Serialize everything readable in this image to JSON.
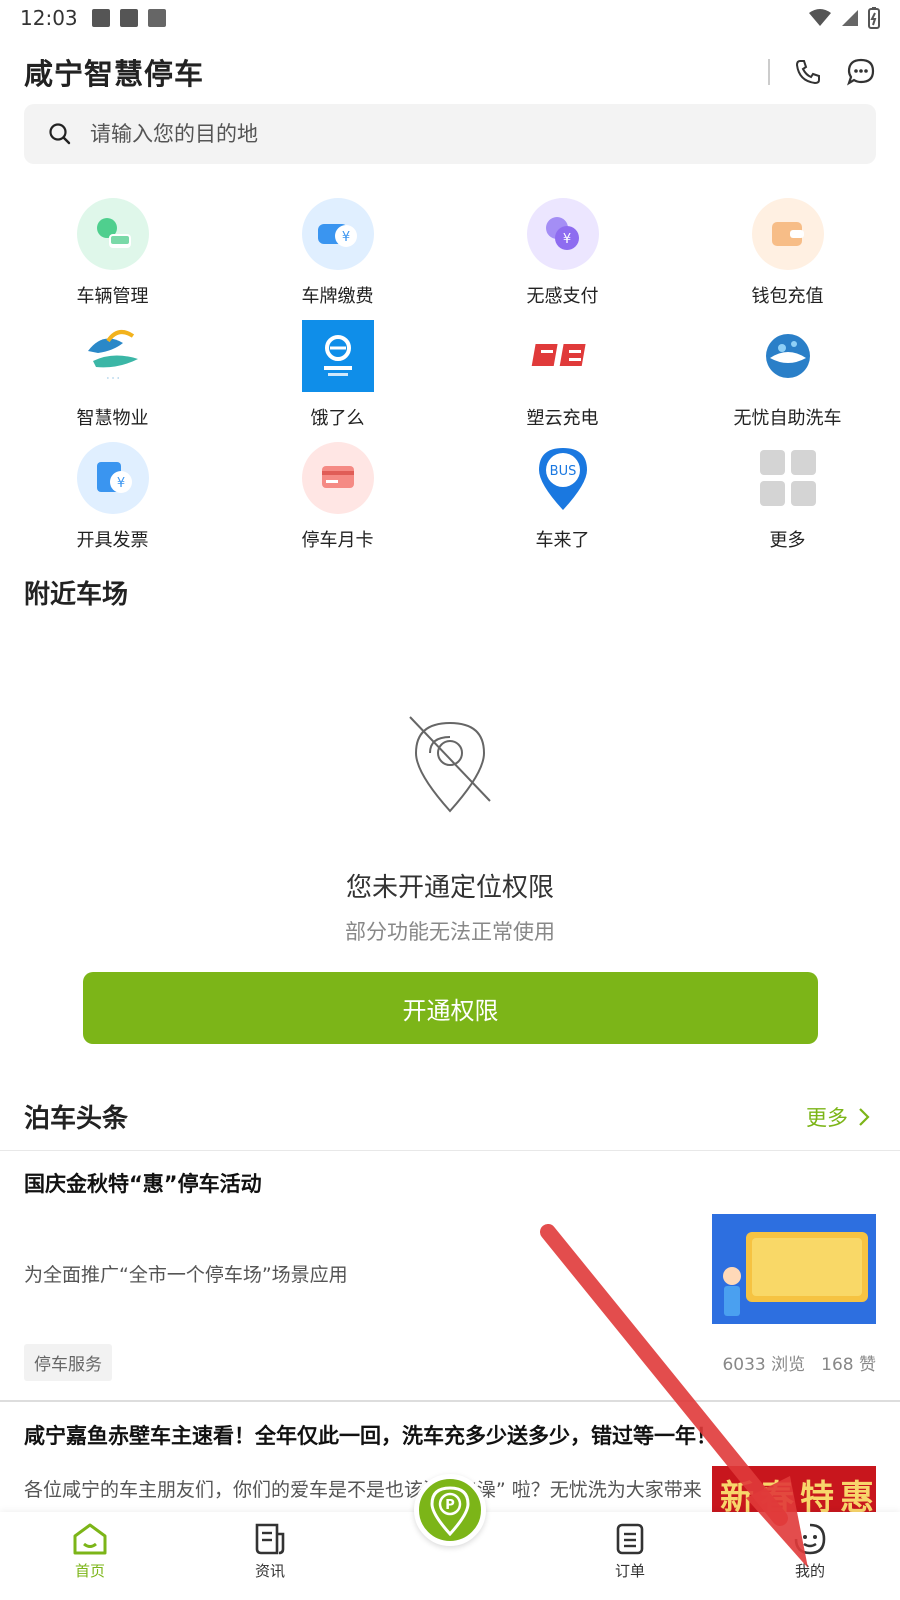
{
  "status_bar": {
    "time": "12:03"
  },
  "header": {
    "title": "咸宁智慧停车"
  },
  "search": {
    "placeholder": "请输入您的目的地"
  },
  "grid": [
    {
      "label": "车辆管理",
      "icon": "car-gear-icon",
      "color": "#4fcf8e"
    },
    {
      "label": "车牌缴费",
      "icon": "car-yuan-icon",
      "color": "#3a95f0"
    },
    {
      "label": "无感支付",
      "icon": "coin-yuan-icon",
      "color": "#8e6cf0"
    },
    {
      "label": "钱包充值",
      "icon": "wallet-icon",
      "color": "#f5a25a"
    },
    {
      "label": "智慧物业",
      "icon": "property-logo-icon",
      "color": "#2a88c8"
    },
    {
      "label": "饿了么",
      "icon": "eleme-logo-icon",
      "color": "#0f8ee9"
    },
    {
      "label": "塑云充电",
      "icon": "suyun-logo-icon",
      "color": "#e03a3a"
    },
    {
      "label": "无忧自助洗车",
      "icon": "carwash-logo-icon",
      "color": "#2a7fc8"
    },
    {
      "label": "开具发票",
      "icon": "invoice-icon",
      "color": "#3a95f0"
    },
    {
      "label": "停车月卡",
      "icon": "card-icon",
      "color": "#f06b6b"
    },
    {
      "label": "车来了",
      "icon": "bus-pin-icon",
      "color": "#1a78e0"
    },
    {
      "label": "更多",
      "icon": "more-grid-icon",
      "color": "#d0d0d0"
    }
  ],
  "nearby": {
    "title": "附近车场",
    "empty_title": "您未开通定位权限",
    "empty_sub": "部分功能无法正常使用",
    "button": "开通权限"
  },
  "news": {
    "title": "泊车头条",
    "more": "更多",
    "items": [
      {
        "title": "国庆金秋特“惠”停车活动",
        "summary": "为全面推广“全市一个停车场”场景应用",
        "tag": "停车服务",
        "views": "6033 浏览",
        "likes": "168 赞"
      },
      {
        "title": "咸宁嘉鱼赤壁车主速看！全年仅此一回，洗车充多少送多少，错过等一年！",
        "summary": "各位咸宁的车主朋友们，你们的爱车是不是也该洗个 “澡” 啦？无忧洗为大家带来一年仅此一次的新春特惠活动"
      }
    ]
  },
  "thumb2_text": "新春特惠",
  "bottom_nav": [
    {
      "label": "首页",
      "icon": "home-icon",
      "active": true
    },
    {
      "label": "资讯",
      "icon": "news-icon",
      "active": false
    },
    {
      "label": "",
      "icon": "parking-icon",
      "active": false
    },
    {
      "label": "订单",
      "icon": "order-icon",
      "active": false
    },
    {
      "label": "我的",
      "icon": "profile-icon",
      "active": false
    }
  ],
  "colors": {
    "accent": "#7cb518",
    "annotation": "#e03a3a"
  }
}
